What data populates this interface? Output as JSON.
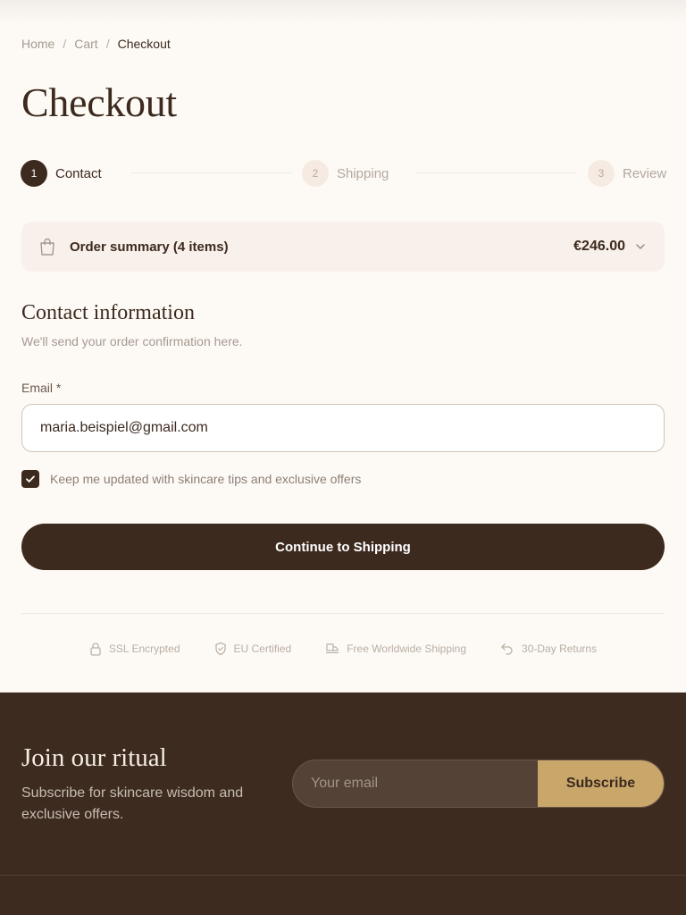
{
  "breadcrumb": {
    "items": [
      "Home",
      "Cart"
    ],
    "current": "Checkout",
    "separator": "/"
  },
  "page_title": "Checkout",
  "steps": [
    {
      "number": "1",
      "label": "Contact",
      "state": "active"
    },
    {
      "number": "2",
      "label": "Shipping",
      "state": "inactive"
    },
    {
      "number": "3",
      "label": "Review",
      "state": "inactive"
    }
  ],
  "order_summary": {
    "label": "Order summary (4 items)",
    "total": "€246.00",
    "icon": "shopping-bag-icon",
    "expand_icon": "chevron-down-icon"
  },
  "contact": {
    "title": "Contact information",
    "subtitle": "We'll send your order confirmation here.",
    "email_label": "Email *",
    "email_value": "maria.beispiel@gmail.com",
    "newsletter_opt_in_label": "Keep me updated with skincare tips and exclusive offers",
    "newsletter_opt_in_checked": true
  },
  "cta_label": "Continue to Shipping",
  "trust_badges": [
    {
      "icon": "lock-icon",
      "label": "SSL Encrypted"
    },
    {
      "icon": "shield-icon",
      "label": "EU Certified"
    },
    {
      "icon": "truck-icon",
      "label": "Free Worldwide Shipping"
    },
    {
      "icon": "return-arrow-icon",
      "label": "30-Day Returns"
    }
  ],
  "footer": {
    "title": "Join our ritual",
    "subtitle": "Subscribe for skincare wisdom and exclusive offers.",
    "email_placeholder": "Your email",
    "subscribe_label": "Subscribe"
  },
  "colors": {
    "primary": "#3d2a1f",
    "accent_gold": "#c9a76b",
    "background": "#fdfaf5",
    "summary_bg": "#f8f0ea"
  }
}
